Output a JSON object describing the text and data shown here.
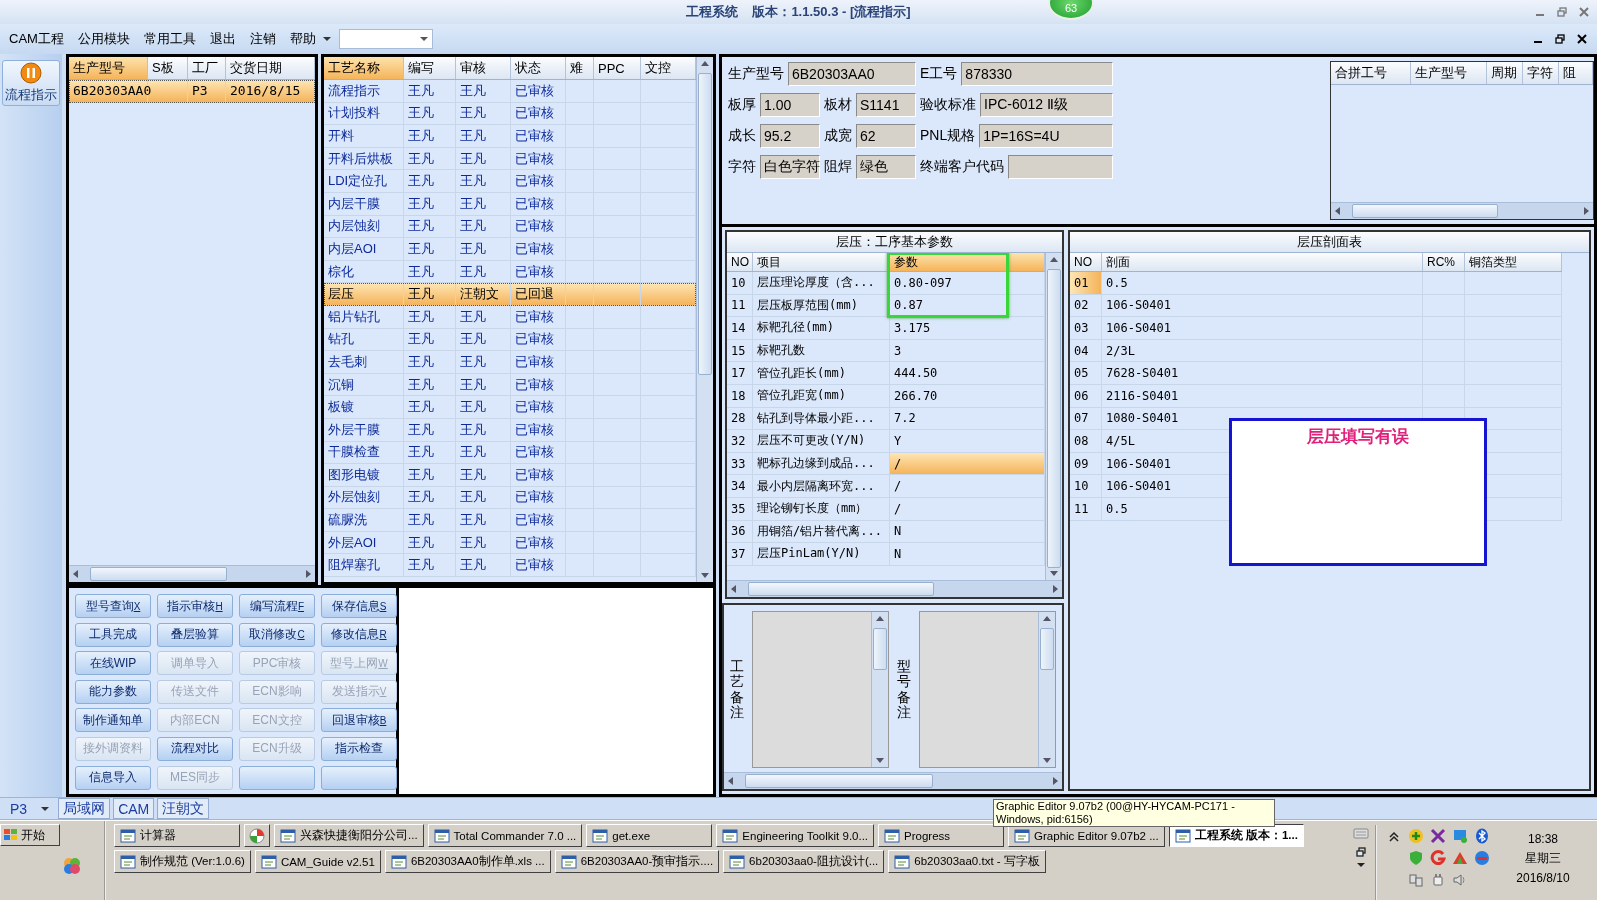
{
  "window": {
    "title": "工程系统",
    "version": "版本：1.1.50.3 - [流程指示]",
    "badge": "63"
  },
  "menu": {
    "items": [
      "CAM工程",
      "公用模块",
      "常用工具",
      "退出",
      "注销",
      "帮助"
    ]
  },
  "side_button": {
    "label": "流程指示"
  },
  "orders": {
    "columns": [
      {
        "label": "生产型号",
        "sorted": true
      },
      {
        "label": "S板",
        "sorted": false
      },
      {
        "label": "工厂",
        "sorted": false
      },
      {
        "label": "交货日期",
        "sorted": false
      }
    ],
    "rows": [
      {
        "model": "6B20303AA0",
        "factory": "P3",
        "date": "2016/8/15",
        "selected": true
      }
    ]
  },
  "process": {
    "columns": [
      {
        "label": "工艺名称",
        "sorted": true
      },
      {
        "label": "编写",
        "sorted": false
      },
      {
        "label": "审核",
        "sorted": false
      },
      {
        "label": "状态",
        "sorted": false
      },
      {
        "label": "难",
        "sorted": false
      },
      {
        "label": "PPC",
        "sorted": false
      },
      {
        "label": "文控",
        "sorted": false
      }
    ],
    "rows": [
      {
        "name": "流程指示",
        "writer": "王凡",
        "reviewer": "王凡",
        "status": "已审核",
        "selected": false
      },
      {
        "name": "计划投料",
        "writer": "王凡",
        "reviewer": "王凡",
        "status": "已审核",
        "selected": false
      },
      {
        "name": "开料",
        "writer": "王凡",
        "reviewer": "王凡",
        "status": "已审核",
        "selected": false
      },
      {
        "name": "开料后烘板",
        "writer": "王凡",
        "reviewer": "王凡",
        "status": "已审核",
        "selected": false
      },
      {
        "name": "LDI定位孔",
        "writer": "王凡",
        "reviewer": "王凡",
        "status": "已审核",
        "selected": false
      },
      {
        "name": "内层干膜",
        "writer": "王凡",
        "reviewer": "王凡",
        "status": "已审核",
        "selected": false
      },
      {
        "name": "内层蚀刻",
        "writer": "王凡",
        "reviewer": "王凡",
        "status": "已审核",
        "selected": false
      },
      {
        "name": "内层AOI",
        "writer": "王凡",
        "reviewer": "王凡",
        "status": "已审核",
        "selected": false
      },
      {
        "name": "棕化",
        "writer": "王凡",
        "reviewer": "王凡",
        "status": "已审核",
        "selected": false
      },
      {
        "name": "层压",
        "writer": "王凡",
        "reviewer": "汪朝文",
        "status": "已回退",
        "selected": true
      },
      {
        "name": "铝片钻孔",
        "writer": "王凡",
        "reviewer": "王凡",
        "status": "已审核",
        "selected": false
      },
      {
        "name": "钻孔",
        "writer": "王凡",
        "reviewer": "王凡",
        "status": "已审核",
        "selected": false
      },
      {
        "name": "去毛刺",
        "writer": "王凡",
        "reviewer": "王凡",
        "status": "已审核",
        "selected": false
      },
      {
        "name": "沉铜",
        "writer": "王凡",
        "reviewer": "王凡",
        "status": "已审核",
        "selected": false
      },
      {
        "name": "板镀",
        "writer": "王凡",
        "reviewer": "王凡",
        "status": "已审核",
        "selected": false
      },
      {
        "name": "外层干膜",
        "writer": "王凡",
        "reviewer": "王凡",
        "status": "已审核",
        "selected": false
      },
      {
        "name": "干膜检查",
        "writer": "王凡",
        "reviewer": "王凡",
        "status": "已审核",
        "selected": false
      },
      {
        "name": "图形电镀",
        "writer": "王凡",
        "reviewer": "王凡",
        "status": "已审核",
        "selected": false
      },
      {
        "name": "外层蚀刻",
        "writer": "王凡",
        "reviewer": "王凡",
        "status": "已审核",
        "selected": false
      },
      {
        "name": "硫脲洗",
        "writer": "王凡",
        "reviewer": "王凡",
        "status": "已审核",
        "selected": false
      },
      {
        "name": "外层AOI",
        "writer": "王凡",
        "reviewer": "王凡",
        "status": "已审核",
        "selected": false
      },
      {
        "name": "阻焊塞孔",
        "writer": "王凡",
        "reviewer": "王凡",
        "status": "已审核",
        "selected": false
      }
    ]
  },
  "buttons": [
    {
      "label": "型号查询",
      "shortcut": "X",
      "disabled": false
    },
    {
      "label": "指示审核",
      "shortcut": "H",
      "disabled": false
    },
    {
      "label": "编写流程",
      "shortcut": "F",
      "disabled": false
    },
    {
      "label": "保存信息",
      "shortcut": "S",
      "disabled": false
    },
    {
      "label": "工具完成",
      "disabled": false
    },
    {
      "label": "叠层验算",
      "disabled": false
    },
    {
      "label": "取消修改",
      "shortcut": "C",
      "disabled": false
    },
    {
      "label": "修改信息",
      "shortcut": "R",
      "disabled": false
    },
    {
      "label": "在线WIP",
      "disabled": false
    },
    {
      "label": "调单导入",
      "disabled": true
    },
    {
      "label": "PPC审核",
      "disabled": true
    },
    {
      "label": "型号上网",
      "shortcut": "W",
      "disabled": true
    },
    {
      "label": "能力参数",
      "disabled": false
    },
    {
      "label": "传送文件",
      "disabled": true
    },
    {
      "label": "ECN影响",
      "disabled": true
    },
    {
      "label": "发送指示",
      "shortcut": "V",
      "disabled": true
    },
    {
      "label": "制作通知单",
      "disabled": false
    },
    {
      "label": "内部ECN",
      "disabled": true
    },
    {
      "label": "ECN文控",
      "disabled": true
    },
    {
      "label": "回退审核",
      "shortcut": "B",
      "disabled": false
    },
    {
      "label": "接外调资料",
      "disabled": true
    },
    {
      "label": "流程对比",
      "disabled": false
    },
    {
      "label": "ECN升级",
      "disabled": true
    },
    {
      "label": "指示检查",
      "disabled": false
    },
    {
      "label": "信息导入",
      "disabled": false
    },
    {
      "label": "MES同步",
      "disabled": true
    },
    {
      "disabled": false
    },
    {
      "disabled": false
    }
  ],
  "info": {
    "fields": [
      {
        "label": "生产型号",
        "value": "6B20303AA0"
      },
      {
        "label": "E工号",
        "value": "878330"
      },
      {
        "label": "板厚",
        "value": "1.00"
      },
      {
        "label": "板材",
        "value": "S1141"
      },
      {
        "label": "验收标准",
        "value": "IPC-6012 Ⅱ级"
      },
      {
        "label": "成长",
        "value": "95.2"
      },
      {
        "label": "成宽",
        "value": "62"
      },
      {
        "label": "PNL规格",
        "value": "1P=16S=4U"
      },
      {
        "label": "字符",
        "value": "白色字符"
      },
      {
        "label": "阻焊",
        "value": "绿色"
      },
      {
        "label": "终端客户代码"
      }
    ]
  },
  "merge_table": {
    "columns": [
      "合拼工号",
      "生产型号",
      "周期",
      "字符",
      "阻"
    ]
  },
  "params": {
    "title": "层压：工序基本参数",
    "columns": [
      {
        "label": "NO",
        "sorted": false
      },
      {
        "label": "项目",
        "sorted": false
      },
      {
        "label": "参数",
        "sorted": true
      }
    ],
    "rows": [
      {
        "no": "10",
        "item": "层压理论厚度（含...",
        "value": "0.80-097",
        "selected": false
      },
      {
        "no": "11",
        "item": "层压板厚范围(mm)",
        "value": "0.87",
        "selected": false
      },
      {
        "no": "14",
        "item": "标靶孔径(mm)",
        "value": "3.175",
        "selected": false
      },
      {
        "no": "15",
        "item": "标靶孔数",
        "value": "3",
        "selected": false
      },
      {
        "no": "17",
        "item": "管位孔距长(mm)",
        "value": "444.50",
        "selected": false
      },
      {
        "no": "18",
        "item": "管位孔距宽(mm)",
        "value": "266.70",
        "selected": false
      },
      {
        "no": "28",
        "item": "钻孔到导体最小距...",
        "value": "7.2",
        "selected": false
      },
      {
        "no": "32",
        "item": "层压不可更改(Y/N)",
        "value": "Y",
        "selected": false
      },
      {
        "no": "33",
        "item": "靶标孔边缘到成品...",
        "value": "/",
        "selected": true
      },
      {
        "no": "34",
        "item": "最小内层隔离环宽...",
        "value": "/",
        "selected": false
      },
      {
        "no": "35",
        "item": "理论铆钉长度（mm）",
        "value": "/",
        "selected": false
      },
      {
        "no": "36",
        "item": "用铜箔/铝片替代离...",
        "value": "N",
        "selected": false
      },
      {
        "no": "37",
        "item": "层压PinLam(Y/N)",
        "value": "N",
        "selected": false
      }
    ]
  },
  "sections": {
    "title": "层压剖面表",
    "columns": [
      "NO",
      "剖面",
      "RC%",
      "铜箔类型"
    ],
    "rows": [
      {
        "no": "01",
        "layer": "0.5",
        "selected": true
      },
      {
        "no": "02",
        "layer": "106-S0401",
        "selected": false
      },
      {
        "no": "03",
        "layer": "106-S0401",
        "selected": false
      },
      {
        "no": "04",
        "layer": "2/3L",
        "selected": false
      },
      {
        "no": "05",
        "layer": "7628-S0401",
        "selected": false
      },
      {
        "no": "06",
        "layer": "2116-S0401",
        "selected": false
      },
      {
        "no": "07",
        "layer": "1080-S0401",
        "selected": false
      },
      {
        "no": "08",
        "layer": "4/5L",
        "selected": false
      },
      {
        "no": "09",
        "layer": "106-S0401",
        "selected": false
      },
      {
        "no": "10",
        "layer": "106-S0401",
        "selected": false
      },
      {
        "no": "11",
        "layer": "0.5",
        "selected": false
      }
    ]
  },
  "review_note": {
    "text": "层压填写有误"
  },
  "remarks": [
    {
      "label": "工艺备注"
    },
    {
      "label": "型号备注"
    }
  ],
  "status_bar": {
    "factory": "P3",
    "tabs": [
      "局域网",
      "CAM",
      "汪朝文"
    ]
  },
  "tooltip": "Graphic Editor 9.07b2 (00@HY-HYCAM-PC171 - Windows, pid:6156)",
  "taskbar": {
    "start": "开始",
    "top_row": [
      {
        "kind": "labeled",
        "label": "计算器",
        "active": false
      },
      {
        "kind": "icon",
        "active": false
      },
      {
        "kind": "labeled",
        "label": "兴森快捷衡阳分公司...",
        "active": false
      },
      {
        "kind": "labeled",
        "label": "Total Commander 7.0 ...",
        "active": false
      },
      {
        "kind": "labeled",
        "label": "get.exe",
        "active": false
      },
      {
        "kind": "labeled",
        "label": "Engineering Toolkit 9.0...",
        "active": false
      },
      {
        "kind": "labeled",
        "label": "Progress",
        "active": false
      },
      {
        "kind": "labeled",
        "label": "Graphic Editor 9.07b2 ...",
        "active": false
      },
      {
        "kind": "labeled",
        "label": "工程系统  版本：1...",
        "active": true
      }
    ],
    "bottom_row": [
      {
        "kind": "labeled",
        "label": "制作规范 (Ver:1.0.6)",
        "active": false
      },
      {
        "kind": "labeled",
        "label": "CAM_Guide v2.51",
        "active": false
      },
      {
        "kind": "labeled",
        "label": "6B20303AA0制作单.xls ...",
        "active": false
      },
      {
        "kind": "labeled",
        "label": "6B20303AA0-预审指示....",
        "active": false
      },
      {
        "kind": "labeled",
        "label": "6b20303aa0-阻抗设计(...",
        "active": false
      },
      {
        "kind": "labeled",
        "label": "6b20303aa0.txt - 写字板",
        "active": false
      }
    ],
    "clock": {
      "time": "18:38",
      "weekday": "星期三",
      "date": "2016/8/10"
    }
  }
}
